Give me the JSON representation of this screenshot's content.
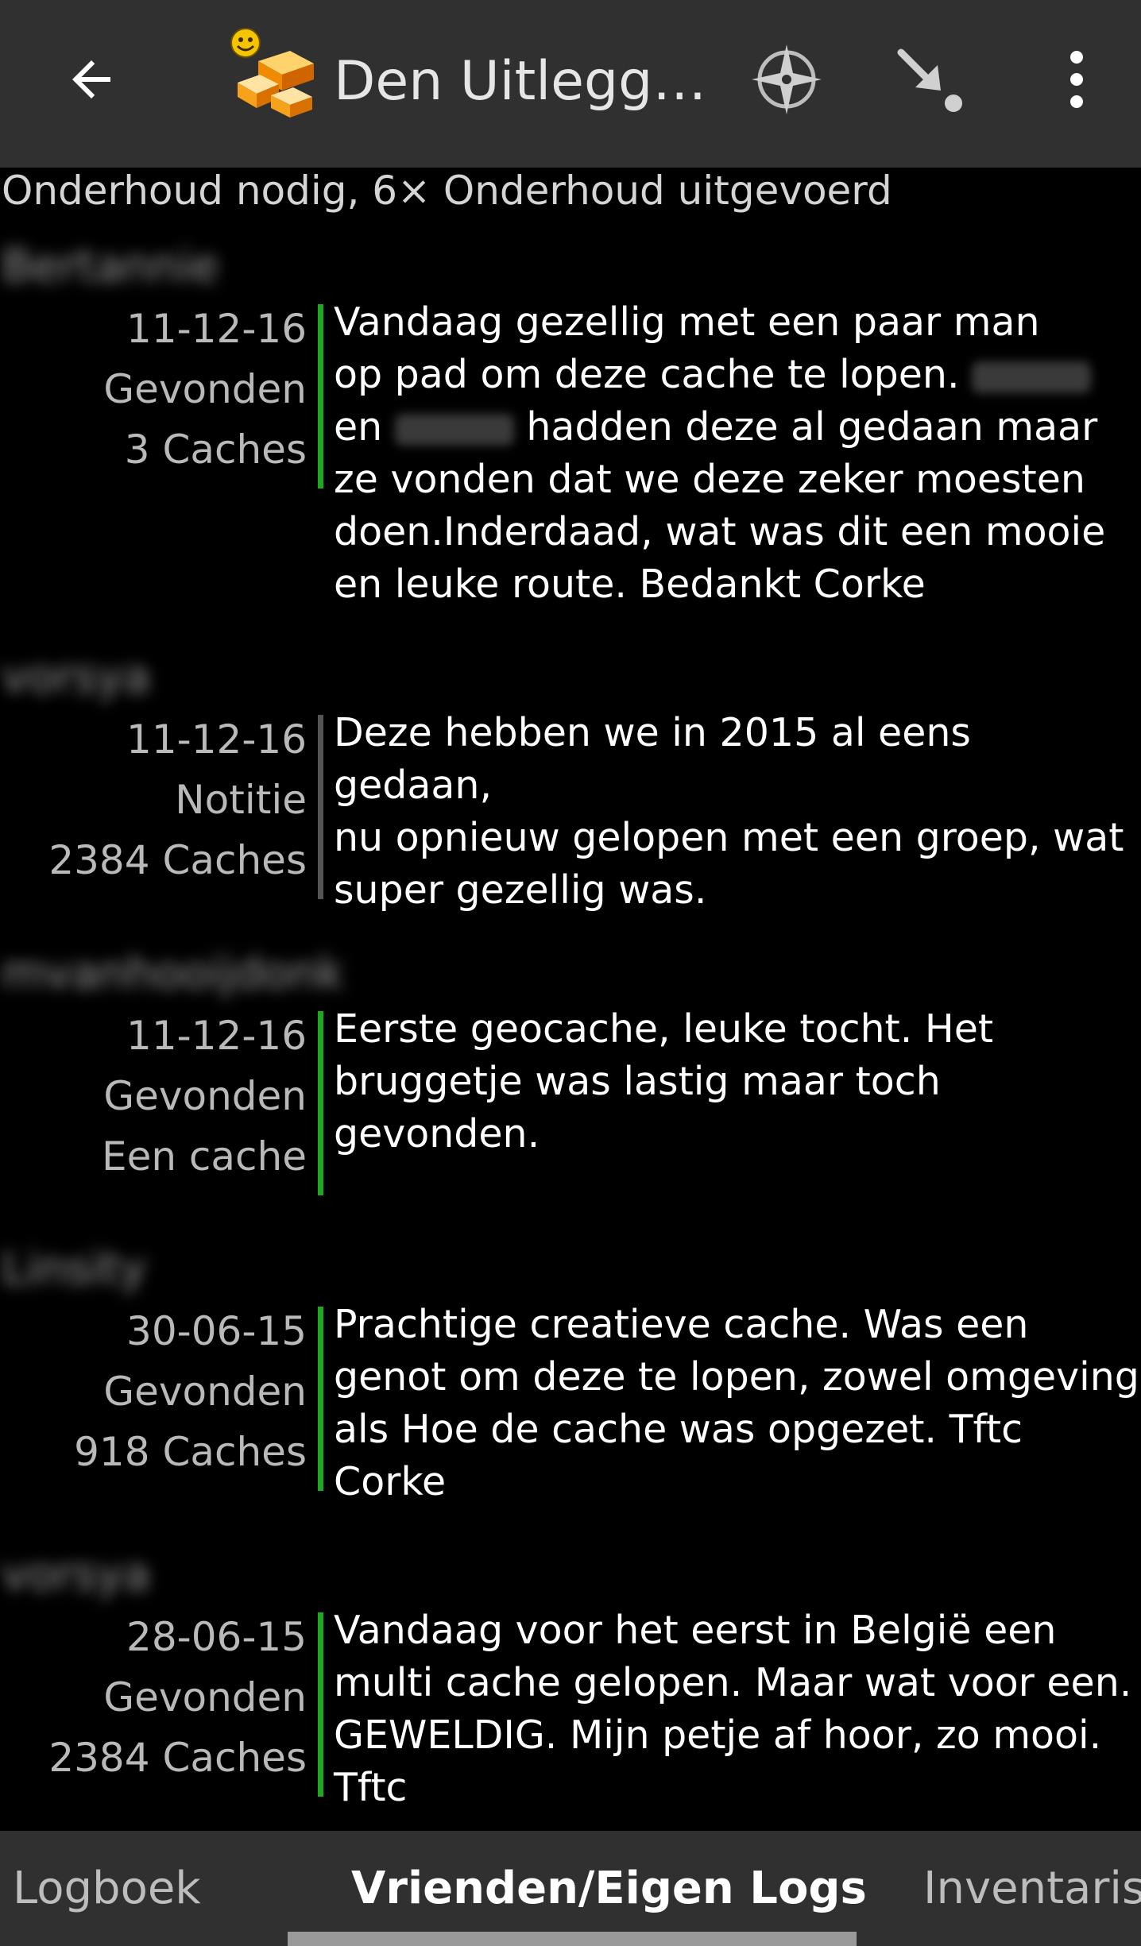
{
  "appbar": {
    "title": "Den Uitlegger…",
    "back_icon": "arrow-left-icon",
    "cache_icon": "multi-cache-icon",
    "compass_icon": "compass-icon",
    "navigate_icon": "navigate-icon",
    "more_icon": "more-vert-icon"
  },
  "summary": "Onderhoud nodig, 6× Onderhoud uitgevoerd",
  "colors": {
    "found": "#1fa81f",
    "note": "#555555",
    "bar_bg": "#303030"
  },
  "logs": [
    {
      "author": "Bertannie",
      "date": "11-12-16",
      "type": "Gevonden",
      "finds": "3 Caches",
      "status": "found",
      "text_part1": "Vandaag gezellig met een paar man\nop pad om deze cache te lopen. ",
      "text_part2": "\nen ",
      "text_part3": " hadden deze al gedaan maar\nze vonden dat we deze zeker moesten\ndoen.Inderdaad, wat was dit een mooie\nen leuke route. Bedankt Corke"
    },
    {
      "author": "vorsya",
      "date": "11-12-16",
      "type": "Notitie",
      "finds": "2384 Caches",
      "status": "note",
      "text": "Deze hebben we in 2015 al eens gedaan,\nnu opnieuw gelopen met een groep, wat\nsuper gezellig was."
    },
    {
      "author": "mvanhooijdonk",
      "date": "11-12-16",
      "type": "Gevonden",
      "finds": "Een cache",
      "status": "found",
      "text": "Eerste geocache, leuke tocht. Het\nbruggetje was lastig maar toch\ngevonden."
    },
    {
      "author": "Linsity",
      "date": "30-06-15",
      "type": "Gevonden",
      "finds": "918 Caches",
      "status": "found",
      "text": "Prachtige creatieve cache. Was een\ngenot om deze te lopen, zowel omgeving\nals Hoe de cache was opgezet. Tftc\nCorke"
    },
    {
      "author": "vorsya",
      "date": "28-06-15",
      "type": "Gevonden",
      "finds": "2384 Caches",
      "status": "found",
      "text": "Vandaag voor het eerst in België een\nmulti cache gelopen. Maar wat voor een.\nGEWELDIG. Mijn petje af hoor, zo mooi.\nTftc"
    }
  ],
  "tabs": [
    {
      "label": "Logboek",
      "active": false
    },
    {
      "label": "Vrienden/Eigen Logs",
      "active": true
    },
    {
      "label": "Inventaris",
      "active": false
    }
  ]
}
